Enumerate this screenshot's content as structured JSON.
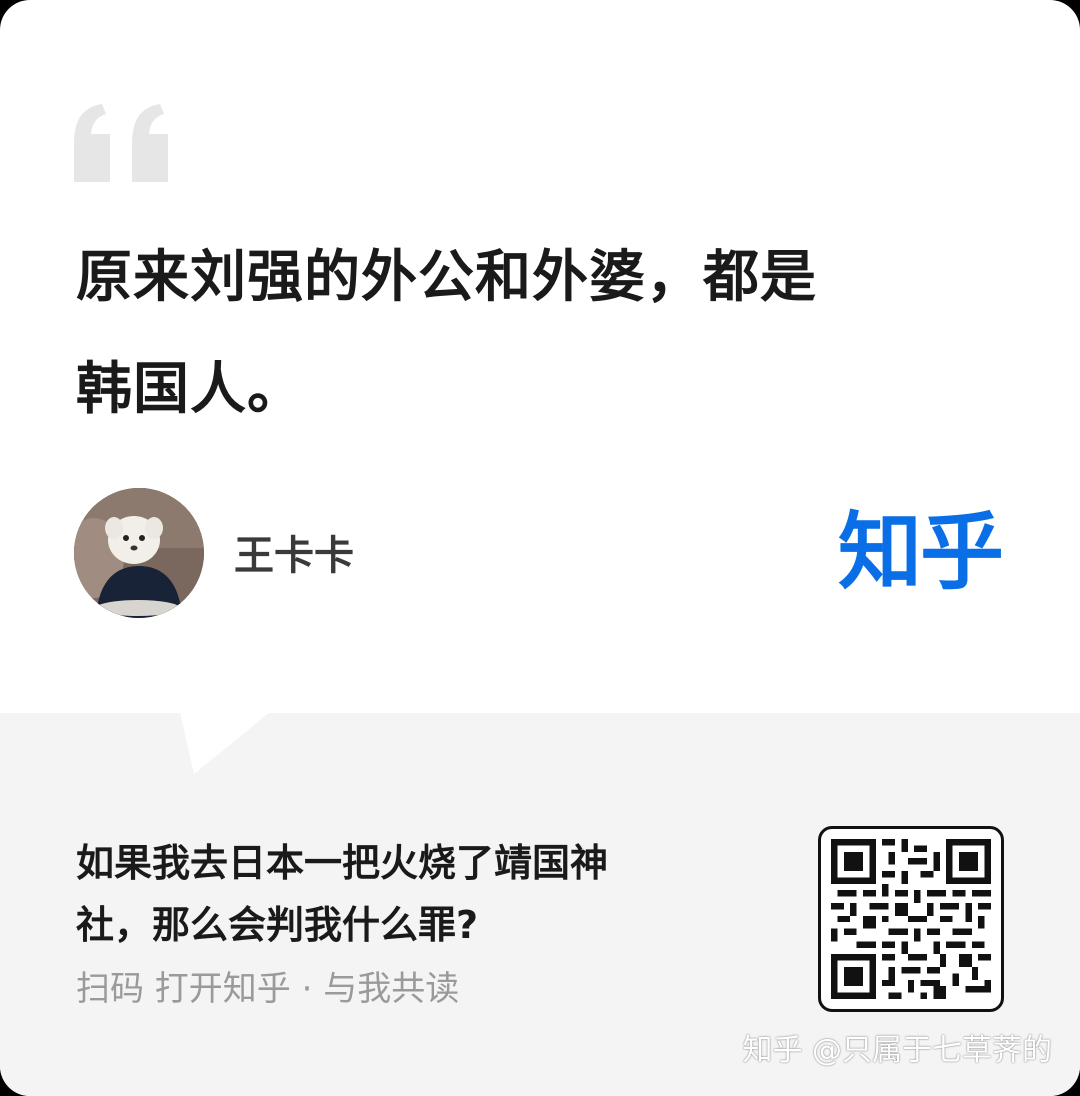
{
  "quote": {
    "line1": "原来刘强的外公和外婆，都是",
    "line2": "韩国人。"
  },
  "author": {
    "name": "王卡卡"
  },
  "brand": {
    "logo_text": "知乎",
    "color": "#0a6ee6"
  },
  "question": {
    "line1": "如果我去日本一把火烧了靖国神",
    "line2": "社，那么会判我什么罪?"
  },
  "footer": {
    "scan_hint": "扫码 打开知乎 · 与我共读"
  },
  "watermark": {
    "text": "知乎 @只属于七草荠的"
  },
  "icons": {
    "quote": "quote-mark-icon",
    "qr": "qr-code-icon"
  },
  "colors": {
    "panel_bg": "#f4f4f4",
    "quote_mark": "#e6e6e6",
    "hint_text": "#9a9a9a"
  }
}
